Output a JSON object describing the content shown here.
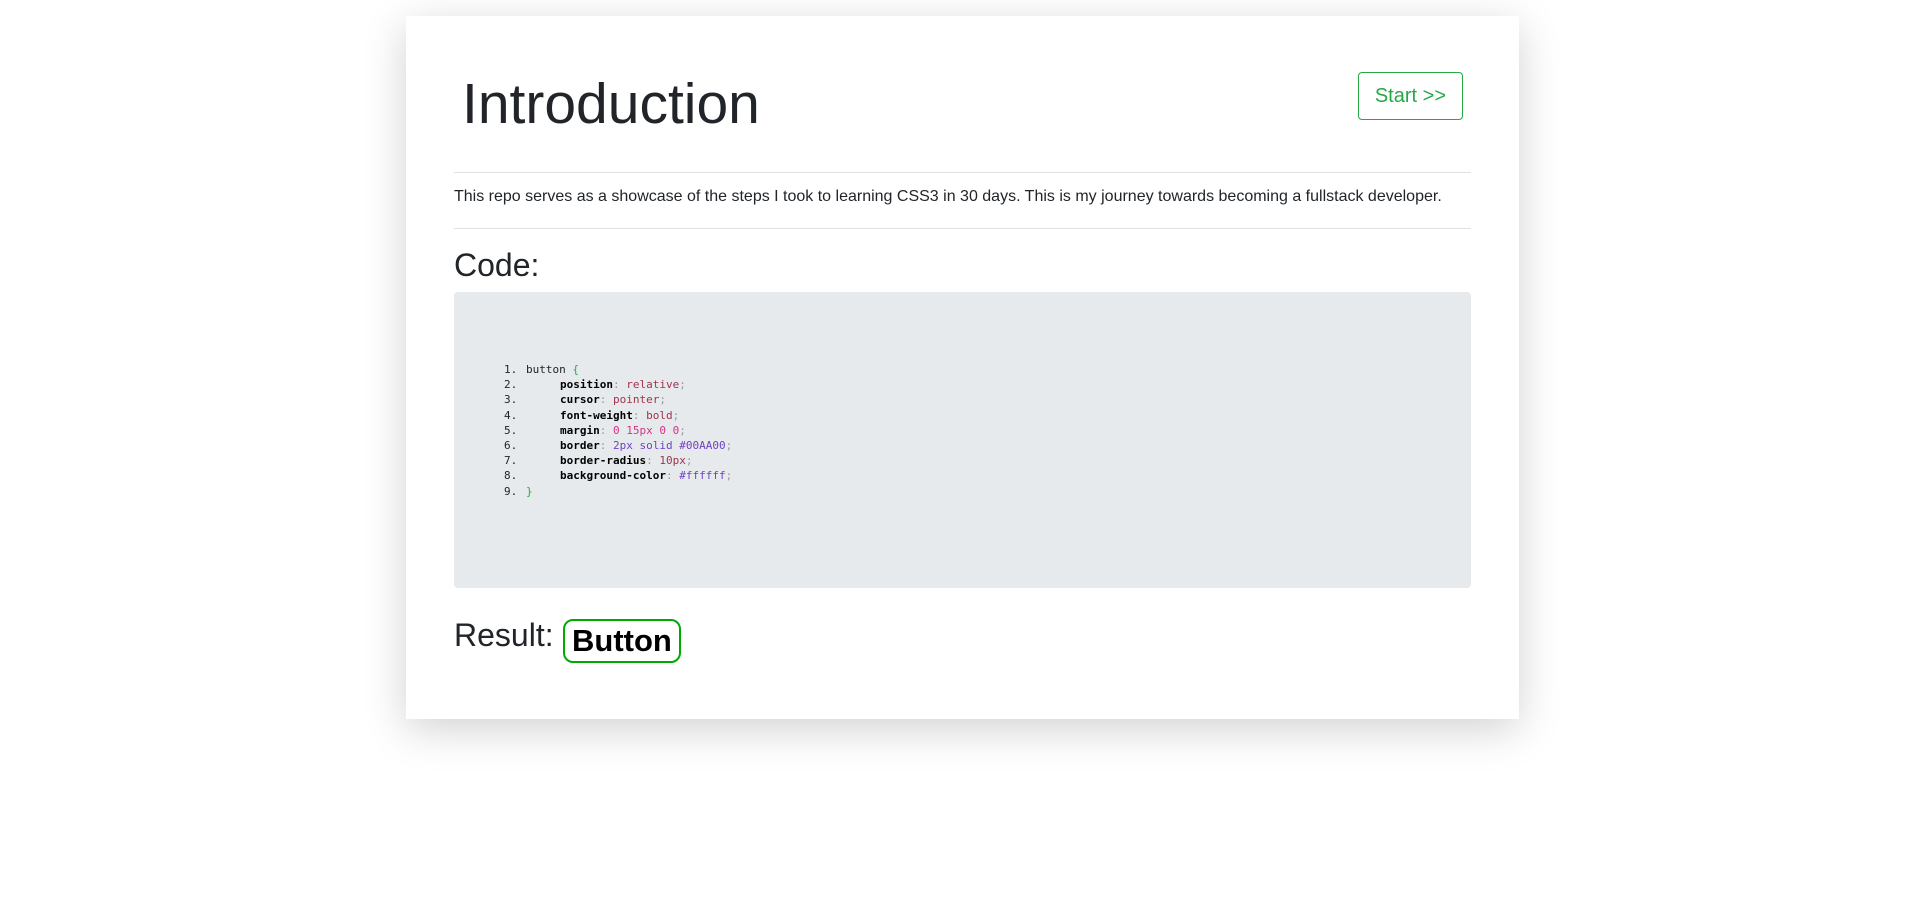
{
  "header": {
    "title": "Introduction",
    "start_label": "Start >>"
  },
  "intro": {
    "text": "This repo serves as a showcase of the steps I took to learning CSS3 in 30 days. This is my journey towards becoming a fullstack developer."
  },
  "code": {
    "heading": "Code:",
    "line_numbers": [
      "1.",
      "2.",
      "3.",
      "4.",
      "5.",
      "6.",
      "7.",
      "8.",
      "9."
    ],
    "selector": "button",
    "open_brace": "{",
    "close_brace": "}",
    "declarations": [
      {
        "property": "position",
        "value": "relative"
      },
      {
        "property": "cursor",
        "value": "pointer"
      },
      {
        "property": "font-weight",
        "value": "bold"
      },
      {
        "property": "margin",
        "value": "0 15px 0 0"
      },
      {
        "property": "border",
        "value": "2px solid #00AA00"
      },
      {
        "property": "border-radius",
        "value": "10px"
      },
      {
        "property": "background-color",
        "value": "#ffffff"
      }
    ]
  },
  "result": {
    "label": "Result:",
    "button_label": "Button"
  },
  "colors": {
    "accent_green": "#28a745",
    "demo_border": "#00AA00",
    "code_background": "#e7eaed"
  }
}
